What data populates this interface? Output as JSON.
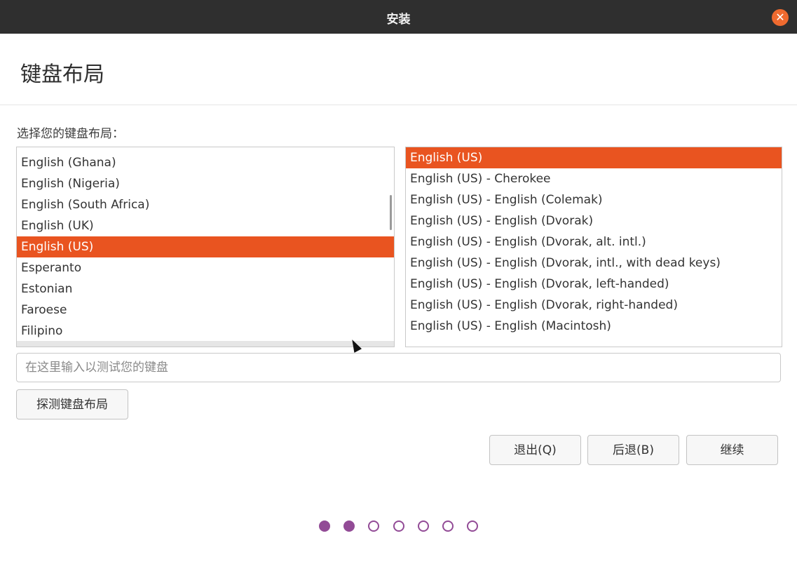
{
  "window": {
    "title": "安装",
    "close_icon": "close-icon"
  },
  "page": {
    "title": "键盘布局",
    "prompt": "选择您的键盘布局："
  },
  "layouts": {
    "items": [
      "English (Ghana)",
      "English (Nigeria)",
      "English (South Africa)",
      "English (UK)",
      "English (US)",
      "Esperanto",
      "Estonian",
      "Faroese",
      "Filipino"
    ],
    "selected": "English (US)"
  },
  "variants": {
    "items": [
      "English (US)",
      "English (US) - Cherokee",
      "English (US) - English (Colemak)",
      "English (US) - English (Dvorak)",
      "English (US) - English (Dvorak, alt. intl.)",
      "English (US) - English (Dvorak, intl., with dead keys)",
      "English (US) - English (Dvorak, left-handed)",
      "English (US) - English (Dvorak, right-handed)",
      "English (US) - English (Macintosh)"
    ],
    "selected": "English (US)"
  },
  "test_input": {
    "placeholder": "在这里输入以测试您的键盘",
    "value": ""
  },
  "buttons": {
    "detect": "探测键盘布局",
    "quit": "退出(Q)",
    "back": "后退(B)",
    "continue": "继续"
  },
  "progress": {
    "total_steps": 7,
    "current_step": 2
  },
  "colors": {
    "selection": "#e95420",
    "titlebar": "#2f2f2f",
    "progress_dot": "#924b96",
    "close_button": "#ef6a2f"
  }
}
